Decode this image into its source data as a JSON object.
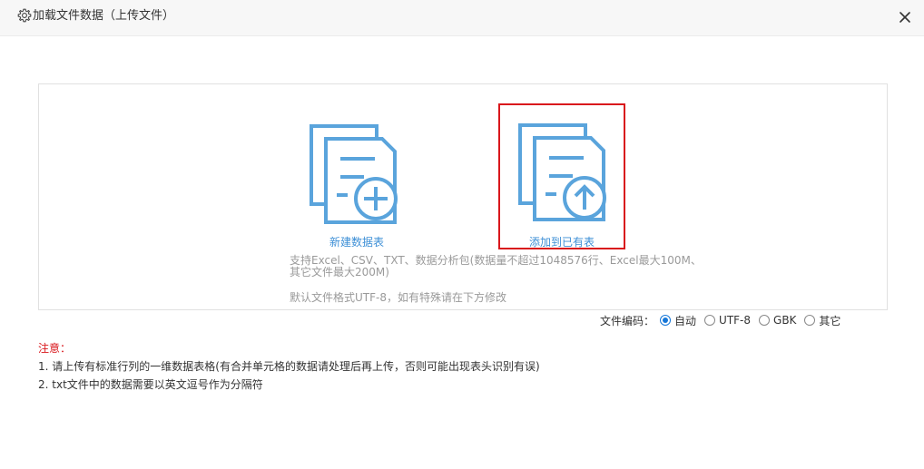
{
  "header": {
    "title": "加载文件数据（上传文件）",
    "icon": "gear-icon",
    "close_icon": "close-icon"
  },
  "options": {
    "new_table": {
      "label": "新建数据表",
      "icon": "document-plus-icon"
    },
    "add_existing": {
      "label": "添加到已有表",
      "icon": "document-upload-icon",
      "highlight_color": "#d9171c"
    }
  },
  "info": {
    "support": "支持Excel、CSV、TXT、数据分析包(数据量不超过1048576行、Excel最大100M、其它文件最大200M)",
    "default_encoding": "默认文件格式UTF-8，如有特殊请在下方修改"
  },
  "encoding": {
    "label": "文件编码：",
    "selected": "自动",
    "options": [
      "自动",
      "UTF-8",
      "GBK",
      "其它"
    ]
  },
  "notes": {
    "title": "注意：",
    "items": [
      "1. 请上传有标准行列的一维数据表格(有合并单元格的数据请处理后再上传，否则可能出现表头识别有误)",
      "2. txt文件中的数据需要以英文逗号作为分隔符"
    ]
  },
  "colors": {
    "accent": "#3d8fd6",
    "icon": "#5aa4dc",
    "warning": "#d9171c",
    "muted_text": "#9a9a9a"
  }
}
